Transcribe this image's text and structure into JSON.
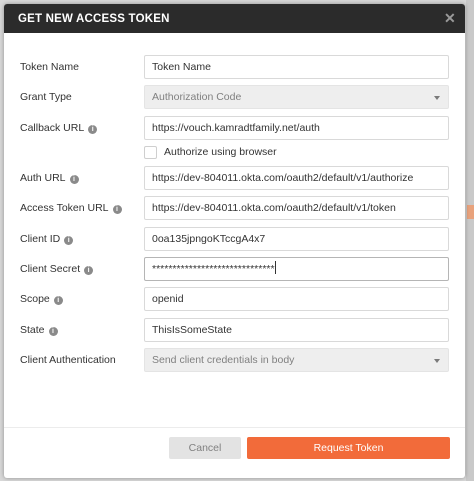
{
  "dialog": {
    "title": "GET NEW ACCESS TOKEN",
    "close_icon": "close-icon",
    "accent_color": "#f26b3a"
  },
  "form": {
    "token_name": {
      "label": "Token Name",
      "value": "Token Name"
    },
    "grant_type": {
      "label": "Grant Type",
      "value": "Authorization Code"
    },
    "callback_url": {
      "label": "Callback URL",
      "value": "https://vouch.kamradtfamily.net/auth"
    },
    "authorize_using_browser": {
      "label": "Authorize using browser",
      "checked": false
    },
    "auth_url": {
      "label": "Auth URL",
      "value": "https://dev-804011.okta.com/oauth2/default/v1/authorize"
    },
    "access_token_url": {
      "label": "Access Token URL",
      "value": "https://dev-804011.okta.com/oauth2/default/v1/token"
    },
    "client_id": {
      "label": "Client ID",
      "value": "0oa135jpngoKTccgA4x7"
    },
    "client_secret": {
      "label": "Client Secret",
      "value": "******************************"
    },
    "scope": {
      "label": "Scope",
      "value": "openid"
    },
    "state": {
      "label": "State",
      "value": "ThisIsSomeState"
    },
    "client_authentication": {
      "label": "Client Authentication",
      "value": "Send client credentials in body"
    }
  },
  "footer": {
    "cancel_label": "Cancel",
    "request_label": "Request Token"
  }
}
